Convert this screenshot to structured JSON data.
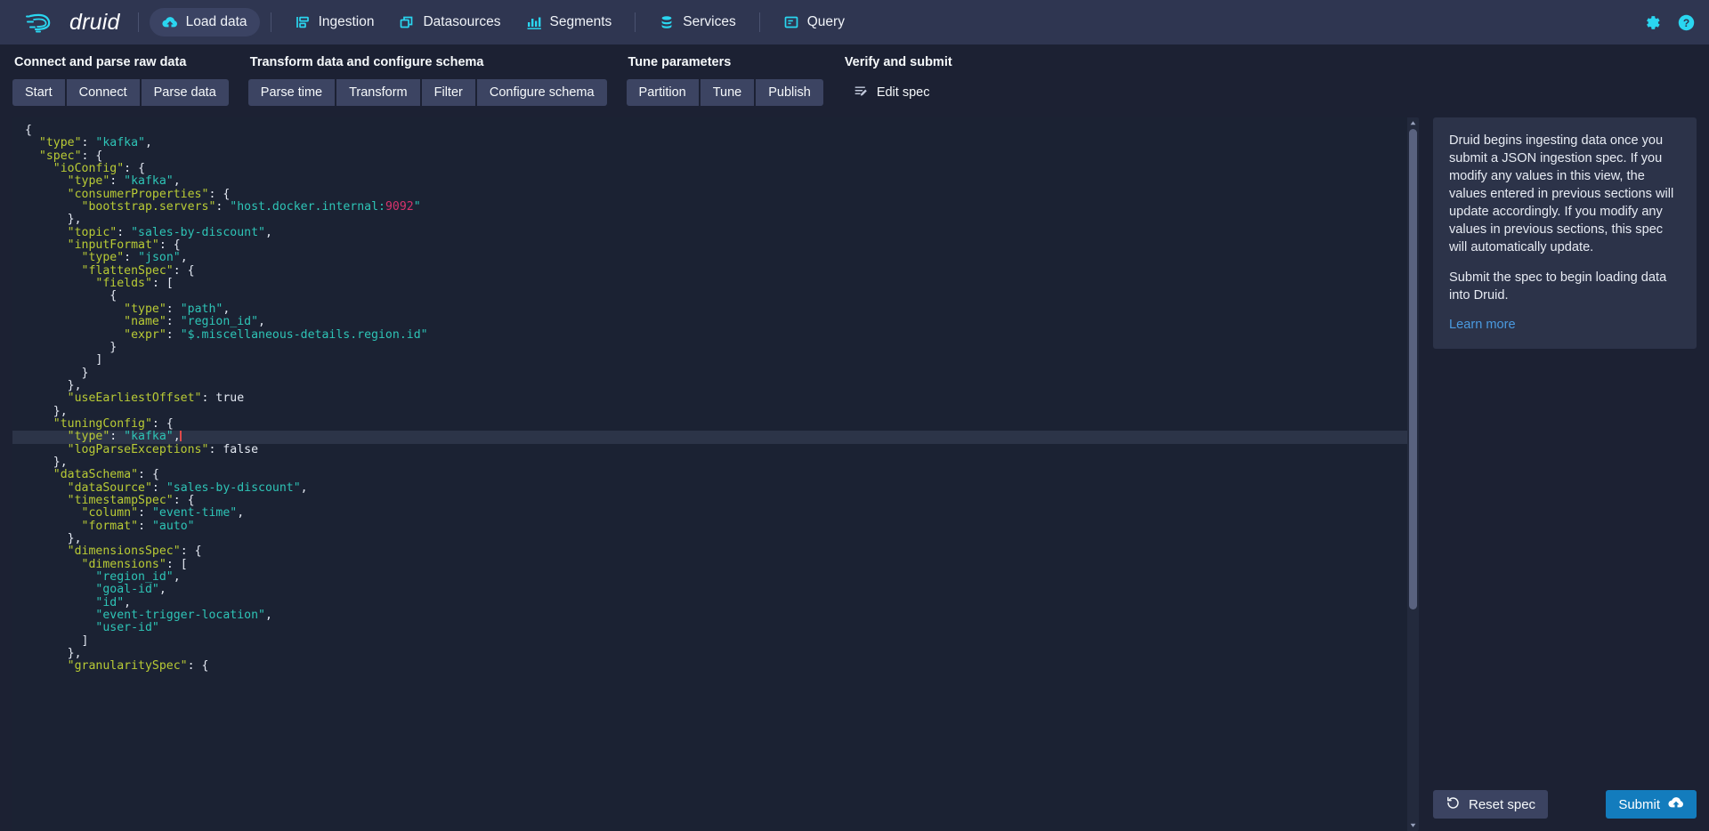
{
  "navbar": {
    "brand": "druid",
    "items": [
      {
        "label": "Load data",
        "icon": "cloud-upload-icon",
        "active": true
      },
      {
        "label": "Ingestion",
        "icon": "ingestion-icon",
        "active": false
      },
      {
        "label": "Datasources",
        "icon": "datasources-icon",
        "active": false
      },
      {
        "label": "Segments",
        "icon": "segments-icon",
        "active": false
      },
      {
        "label": "Services",
        "icon": "services-icon",
        "active": false
      },
      {
        "label": "Query",
        "icon": "query-icon",
        "active": false
      }
    ],
    "right": [
      {
        "label": "Settings",
        "icon": "gear-icon"
      },
      {
        "label": "Help",
        "icon": "help-icon"
      }
    ]
  },
  "steps": {
    "groups": [
      {
        "title": "Connect and parse raw data",
        "buttons": [
          "Start",
          "Connect",
          "Parse data"
        ]
      },
      {
        "title": "Transform data and configure schema",
        "buttons": [
          "Parse time",
          "Transform",
          "Filter",
          "Configure schema"
        ]
      },
      {
        "title": "Tune parameters",
        "buttons": [
          "Partition",
          "Tune",
          "Publish"
        ]
      },
      {
        "title": "Verify and submit",
        "buttons": [
          "Edit spec"
        ]
      }
    ]
  },
  "editor": {
    "active_line_index": 24,
    "lines": [
      [
        {
          "t": "brace",
          "v": "{"
        }
      ],
      [
        {
          "t": "sp",
          "v": "  "
        },
        {
          "t": "key",
          "v": "\"type\""
        },
        {
          "t": "punc",
          "v": ": "
        },
        {
          "t": "str",
          "v": "\"kafka\""
        },
        {
          "t": "punc",
          "v": ","
        }
      ],
      [
        {
          "t": "sp",
          "v": "  "
        },
        {
          "t": "key",
          "v": "\"spec\""
        },
        {
          "t": "punc",
          "v": ": "
        },
        {
          "t": "brace",
          "v": "{"
        }
      ],
      [
        {
          "t": "sp",
          "v": "    "
        },
        {
          "t": "key",
          "v": "\"ioConfig\""
        },
        {
          "t": "punc",
          "v": ": "
        },
        {
          "t": "brace",
          "v": "{"
        }
      ],
      [
        {
          "t": "sp",
          "v": "      "
        },
        {
          "t": "key",
          "v": "\"type\""
        },
        {
          "t": "punc",
          "v": ": "
        },
        {
          "t": "str",
          "v": "\"kafka\""
        },
        {
          "t": "punc",
          "v": ","
        }
      ],
      [
        {
          "t": "sp",
          "v": "      "
        },
        {
          "t": "key",
          "v": "\"consumerProperties\""
        },
        {
          "t": "punc",
          "v": ": "
        },
        {
          "t": "brace",
          "v": "{"
        }
      ],
      [
        {
          "t": "sp",
          "v": "        "
        },
        {
          "t": "key",
          "v": "\"bootstrap.servers\""
        },
        {
          "t": "punc",
          "v": ": "
        },
        {
          "t": "str",
          "v": "\"host.docker.internal:"
        },
        {
          "t": "num",
          "v": "9092"
        },
        {
          "t": "str",
          "v": "\""
        }
      ],
      [
        {
          "t": "sp",
          "v": "      "
        },
        {
          "t": "brace",
          "v": "}"
        },
        {
          "t": "punc",
          "v": ","
        }
      ],
      [
        {
          "t": "sp",
          "v": "      "
        },
        {
          "t": "key",
          "v": "\"topic\""
        },
        {
          "t": "punc",
          "v": ": "
        },
        {
          "t": "str",
          "v": "\"sales-by-discount\""
        },
        {
          "t": "punc",
          "v": ","
        }
      ],
      [
        {
          "t": "sp",
          "v": "      "
        },
        {
          "t": "key",
          "v": "\"inputFormat\""
        },
        {
          "t": "punc",
          "v": ": "
        },
        {
          "t": "brace",
          "v": "{"
        }
      ],
      [
        {
          "t": "sp",
          "v": "        "
        },
        {
          "t": "key",
          "v": "\"type\""
        },
        {
          "t": "punc",
          "v": ": "
        },
        {
          "t": "str",
          "v": "\"json\""
        },
        {
          "t": "punc",
          "v": ","
        }
      ],
      [
        {
          "t": "sp",
          "v": "        "
        },
        {
          "t": "key",
          "v": "\"flattenSpec\""
        },
        {
          "t": "punc",
          "v": ": "
        },
        {
          "t": "brace",
          "v": "{"
        }
      ],
      [
        {
          "t": "sp",
          "v": "          "
        },
        {
          "t": "key",
          "v": "\"fields\""
        },
        {
          "t": "punc",
          "v": ": "
        },
        {
          "t": "brace",
          "v": "["
        }
      ],
      [
        {
          "t": "sp",
          "v": "            "
        },
        {
          "t": "brace",
          "v": "{"
        }
      ],
      [
        {
          "t": "sp",
          "v": "              "
        },
        {
          "t": "key",
          "v": "\"type\""
        },
        {
          "t": "punc",
          "v": ": "
        },
        {
          "t": "str",
          "v": "\"path\""
        },
        {
          "t": "punc",
          "v": ","
        }
      ],
      [
        {
          "t": "sp",
          "v": "              "
        },
        {
          "t": "key",
          "v": "\"name\""
        },
        {
          "t": "punc",
          "v": ": "
        },
        {
          "t": "str",
          "v": "\"region_id\""
        },
        {
          "t": "punc",
          "v": ","
        }
      ],
      [
        {
          "t": "sp",
          "v": "              "
        },
        {
          "t": "key",
          "v": "\"expr\""
        },
        {
          "t": "punc",
          "v": ": "
        },
        {
          "t": "str",
          "v": "\"$.miscellaneous-details.region.id\""
        }
      ],
      [
        {
          "t": "sp",
          "v": "            "
        },
        {
          "t": "brace",
          "v": "}"
        }
      ],
      [
        {
          "t": "sp",
          "v": "          "
        },
        {
          "t": "brace",
          "v": "]"
        }
      ],
      [
        {
          "t": "sp",
          "v": "        "
        },
        {
          "t": "brace",
          "v": "}"
        }
      ],
      [
        {
          "t": "sp",
          "v": "      "
        },
        {
          "t": "brace",
          "v": "}"
        },
        {
          "t": "punc",
          "v": ","
        }
      ],
      [
        {
          "t": "sp",
          "v": "      "
        },
        {
          "t": "key",
          "v": "\"useEarliestOffset\""
        },
        {
          "t": "punc",
          "v": ": "
        },
        {
          "t": "bool",
          "v": "true"
        }
      ],
      [
        {
          "t": "sp",
          "v": "    "
        },
        {
          "t": "brace",
          "v": "}"
        },
        {
          "t": "punc",
          "v": ","
        }
      ],
      [
        {
          "t": "sp",
          "v": "    "
        },
        {
          "t": "key",
          "v": "\"tuningConfig\""
        },
        {
          "t": "punc",
          "v": ": "
        },
        {
          "t": "brace",
          "v": "{"
        }
      ],
      [
        {
          "t": "sp",
          "v": "      "
        },
        {
          "t": "key",
          "v": "\"type\""
        },
        {
          "t": "punc",
          "v": ": "
        },
        {
          "t": "str",
          "v": "\"kafka\""
        },
        {
          "t": "punc",
          "v": ","
        },
        {
          "t": "caret",
          "v": ""
        }
      ],
      [
        {
          "t": "sp",
          "v": "      "
        },
        {
          "t": "key",
          "v": "\"logParseExceptions\""
        },
        {
          "t": "punc",
          "v": ": "
        },
        {
          "t": "bool",
          "v": "false"
        }
      ],
      [
        {
          "t": "sp",
          "v": "    "
        },
        {
          "t": "brace",
          "v": "}"
        },
        {
          "t": "punc",
          "v": ","
        }
      ],
      [
        {
          "t": "sp",
          "v": "    "
        },
        {
          "t": "key",
          "v": "\"dataSchema\""
        },
        {
          "t": "punc",
          "v": ": "
        },
        {
          "t": "brace",
          "v": "{"
        }
      ],
      [
        {
          "t": "sp",
          "v": "      "
        },
        {
          "t": "key",
          "v": "\"dataSource\""
        },
        {
          "t": "punc",
          "v": ": "
        },
        {
          "t": "str",
          "v": "\"sales-by-discount\""
        },
        {
          "t": "punc",
          "v": ","
        }
      ],
      [
        {
          "t": "sp",
          "v": "      "
        },
        {
          "t": "key",
          "v": "\"timestampSpec\""
        },
        {
          "t": "punc",
          "v": ": "
        },
        {
          "t": "brace",
          "v": "{"
        }
      ],
      [
        {
          "t": "sp",
          "v": "        "
        },
        {
          "t": "key",
          "v": "\"column\""
        },
        {
          "t": "punc",
          "v": ": "
        },
        {
          "t": "str",
          "v": "\"event-time\""
        },
        {
          "t": "punc",
          "v": ","
        }
      ],
      [
        {
          "t": "sp",
          "v": "        "
        },
        {
          "t": "key",
          "v": "\"format\""
        },
        {
          "t": "punc",
          "v": ": "
        },
        {
          "t": "str",
          "v": "\"auto\""
        }
      ],
      [
        {
          "t": "sp",
          "v": "      "
        },
        {
          "t": "brace",
          "v": "}"
        },
        {
          "t": "punc",
          "v": ","
        }
      ],
      [
        {
          "t": "sp",
          "v": "      "
        },
        {
          "t": "key",
          "v": "\"dimensionsSpec\""
        },
        {
          "t": "punc",
          "v": ": "
        },
        {
          "t": "brace",
          "v": "{"
        }
      ],
      [
        {
          "t": "sp",
          "v": "        "
        },
        {
          "t": "key",
          "v": "\"dimensions\""
        },
        {
          "t": "punc",
          "v": ": "
        },
        {
          "t": "brace",
          "v": "["
        }
      ],
      [
        {
          "t": "sp",
          "v": "          "
        },
        {
          "t": "str",
          "v": "\"region_id\""
        },
        {
          "t": "punc",
          "v": ","
        }
      ],
      [
        {
          "t": "sp",
          "v": "          "
        },
        {
          "t": "str",
          "v": "\"goal-id\""
        },
        {
          "t": "punc",
          "v": ","
        }
      ],
      [
        {
          "t": "sp",
          "v": "          "
        },
        {
          "t": "str",
          "v": "\"id\""
        },
        {
          "t": "punc",
          "v": ","
        }
      ],
      [
        {
          "t": "sp",
          "v": "          "
        },
        {
          "t": "str",
          "v": "\"event-trigger-location\""
        },
        {
          "t": "punc",
          "v": ","
        }
      ],
      [
        {
          "t": "sp",
          "v": "          "
        },
        {
          "t": "str",
          "v": "\"user-id\""
        }
      ],
      [
        {
          "t": "sp",
          "v": "        "
        },
        {
          "t": "brace",
          "v": "]"
        }
      ],
      [
        {
          "t": "sp",
          "v": "      "
        },
        {
          "t": "brace",
          "v": "}"
        },
        {
          "t": "punc",
          "v": ","
        }
      ],
      [
        {
          "t": "sp",
          "v": "      "
        },
        {
          "t": "key",
          "v": "\"granularitySpec\""
        },
        {
          "t": "punc",
          "v": ": "
        },
        {
          "t": "brace",
          "v": "{"
        }
      ]
    ]
  },
  "side_panel": {
    "paragraphs": [
      "Druid begins ingesting data once you submit a JSON ingestion spec. If you modify any values in this view, the values entered in previous sections will update accordingly. If you modify any values in previous sections, this spec will automatically update.",
      "Submit the spec to begin loading data into Druid."
    ],
    "learn_more": "Learn more",
    "reset_label": "Reset spec",
    "submit_label": "Submit"
  },
  "colors": {
    "brand_cyan": "#2ad6f0",
    "accent_blue": "#137cbd",
    "navbar_bg": "#2f3651",
    "page_bg": "#1c2133",
    "editor_bg": "#1b2233",
    "link": "#4a9ae0",
    "json_key": "#b9cb35",
    "json_string": "#2ec4b6",
    "json_number": "#d6336c",
    "caret": "#e04a4a"
  }
}
